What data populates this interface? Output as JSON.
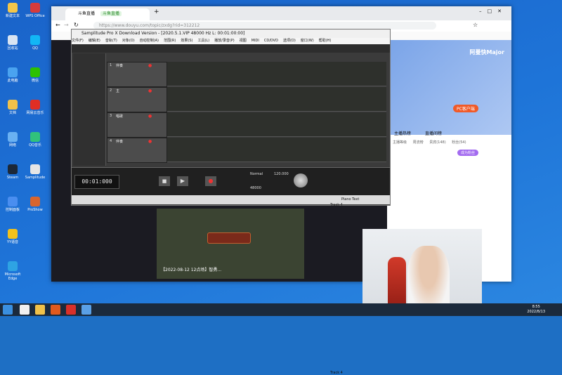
{
  "desktop": {
    "icons": [
      {
        "label": "新建文本",
        "color": "#f3c64a"
      },
      {
        "label": "回收站",
        "color": "#d9e4f2"
      },
      {
        "label": "此电脑",
        "color": "#4aa3f0"
      },
      {
        "label": "文档",
        "color": "#f0c14a"
      },
      {
        "label": "网络",
        "color": "#6ab1f2"
      },
      {
        "label": "Steam",
        "color": "#1c2838"
      },
      {
        "label": "控制面板",
        "color": "#4a8ef0"
      },
      {
        "label": "YY语音",
        "color": "#f2c21b"
      },
      {
        "label": "Microsoft Edge",
        "color": "#2ea3e3"
      },
      {
        "label": "WPS Office",
        "color": "#d63b3b"
      },
      {
        "label": "QQ",
        "color": "#12b7f5"
      },
      {
        "label": "微信",
        "color": "#2dc100"
      },
      {
        "label": "网易云音乐",
        "color": "#e02e24"
      },
      {
        "label": "QQ音乐",
        "color": "#31c27c"
      },
      {
        "label": "Samplitude",
        "color": "#e5e5e5"
      },
      {
        "label": "ProShow",
        "color": "#d8652d"
      }
    ]
  },
  "browser": {
    "tab_title": "斗鱼直播",
    "tab_badge": "斗鱼直播",
    "url": "https://www.douyu.com/topic/zxdg?rid=312212",
    "right_panel": {
      "streamer": "阿曼快Major",
      "pk_button": "PC客户端",
      "tabs": [
        "主播热榜",
        "直播间榜"
      ],
      "subtabs": [
        "主播等级",
        "周流榜",
        "贵宾(148)",
        "粉丝(54)"
      ],
      "follow_label": "成为粉丝"
    },
    "video_caption": "【2022-08-12 12点场】智勇..."
  },
  "samplitude": {
    "title": "Samplitude Pro X Download Version - [2020.5.1.VIP  48000 Hz L: 00:01:00:00]",
    "menu": [
      "文件(F)",
      "编辑(E)",
      "音轨(T)",
      "对象(O)",
      "自动控制(A)",
      "范围(R)",
      "效果(S)",
      "工具(L)",
      "播放/录音(P)",
      "视图",
      "MIDI",
      "CD/DVD",
      "选项(O)",
      "窗口(W)",
      "帮助(H)"
    ],
    "tracks": [
      {
        "num": "1",
        "name": "伴奏"
      },
      {
        "num": "2",
        "name": "主"
      },
      {
        "num": "3",
        "name": "唱歌"
      },
      {
        "num": "4",
        "name": "伴奏"
      }
    ],
    "timecode": "00:01:000",
    "sample_rate": "48000",
    "mode": "Normal",
    "bpm": "120.000",
    "track_status": "Track 4",
    "free_text": "Piano Text"
  },
  "taskbar": {
    "time": "8:55",
    "date": "2022/8/13"
  },
  "colors": {
    "desktop": "#1e74d8",
    "taskbar": "#1b2a3c",
    "samp_dark": "#3b3b3b"
  }
}
